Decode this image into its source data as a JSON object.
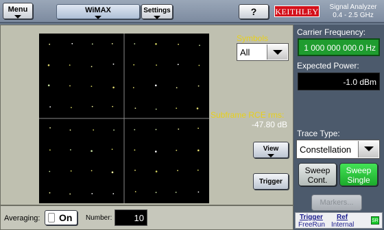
{
  "topbar": {
    "menu_label": "Menu",
    "mode_label": "WiMAX",
    "settings_label": "Settings",
    "help_label": "?",
    "brand": "KEITHLEY",
    "title_line1": "Signal Analyzer",
    "title_line2": "0.4 - 2.5 GHz"
  },
  "main": {
    "symbols_label": "Symbols",
    "symbols_value": "All",
    "rce_label": "Subframe RCE rms:",
    "rce_value": "-47.80 dB",
    "view_label": "View",
    "trigger_label": "Trigger"
  },
  "bottom": {
    "averaging_label": "Averaging:",
    "averaging_state": "On",
    "number_label": "Number:",
    "number_value": "10"
  },
  "right": {
    "carrier_label": "Carrier Frequency:",
    "carrier_value": "1 000 000 000.0 Hz",
    "power_label": "Expected Power:",
    "power_value": "-1.0 dBm",
    "trace_label": "Trace Type:",
    "trace_value": "Constellation",
    "sweep_cont_line1": "Sweep",
    "sweep_cont_line2": "Cont.",
    "sweep_single_line1": "Sweep",
    "sweep_single_line2": "Single",
    "markers_label": "Markers...",
    "status_trigger_label": "Trigger",
    "status_trigger_value": "FreeRun",
    "status_ref_label": "Ref",
    "status_ref_value": "Internal",
    "led_text": "SR"
  },
  "colors": {
    "accent_yellow": "#e8d01a",
    "active_green": "#1faa2e",
    "brand_red": "#d4101a",
    "panel_bg": "#bfc0b0",
    "right_panel_bg": "#4c5a6c"
  }
}
